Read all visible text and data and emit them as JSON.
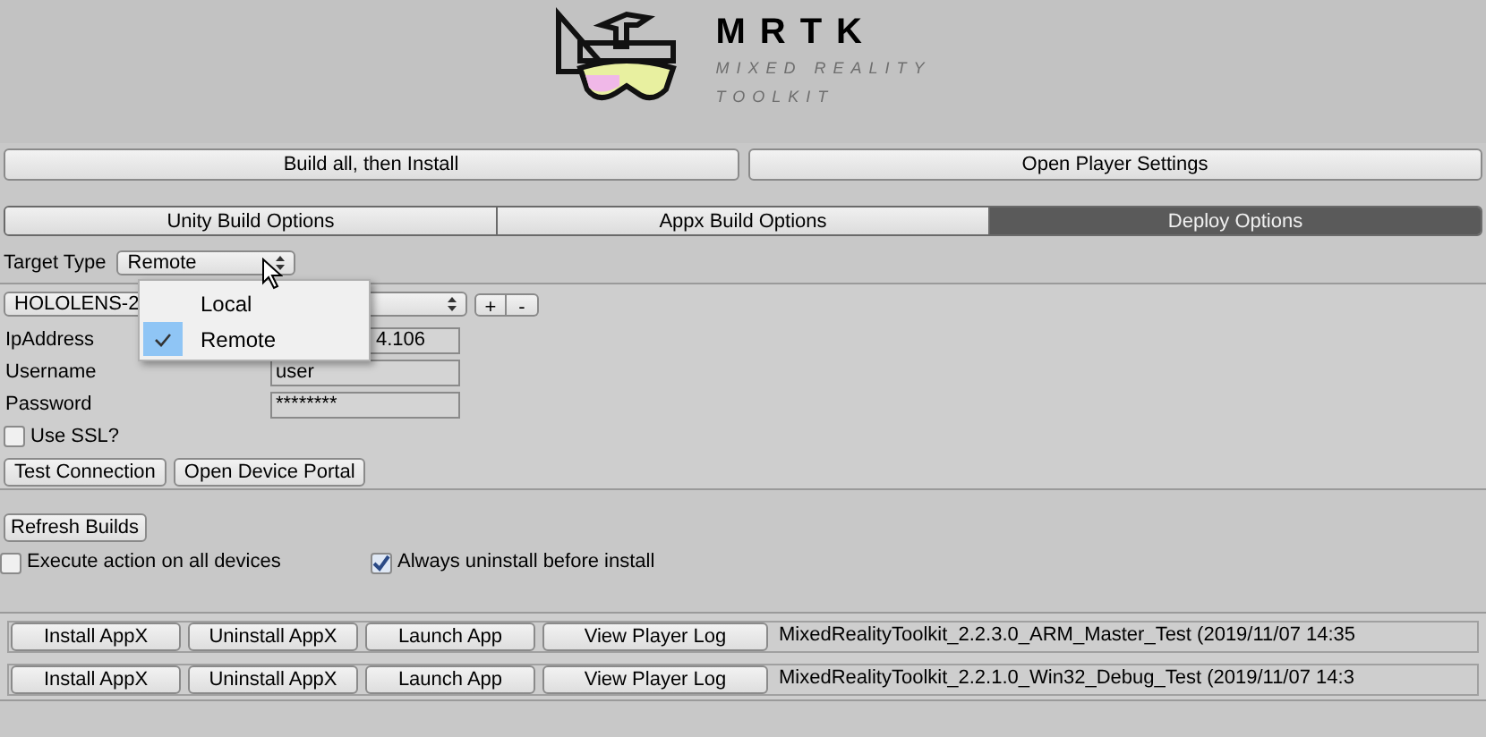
{
  "logo": {
    "title": "MRTK",
    "subtitle_lines": [
      "MIXED REALITY",
      "TOOLKIT"
    ]
  },
  "top_buttons": [
    "Build all, then Install",
    "Open Player Settings"
  ],
  "tabs": [
    {
      "label": "Unity Build Options",
      "selected": false
    },
    {
      "label": "Appx Build Options",
      "selected": false
    },
    {
      "label": "Deploy Options",
      "selected": true
    }
  ],
  "target_type": {
    "label": "Target Type",
    "value": "Remote",
    "menu": [
      {
        "label": "Local",
        "selected": false
      },
      {
        "label": "Remote",
        "selected": true
      }
    ]
  },
  "device": {
    "dropdown": "HOLOLENS-2",
    "add": "+",
    "remove": "-",
    "fields": [
      {
        "label": "IpAddress",
        "value": "4.106"
      },
      {
        "label": "Username",
        "value": "user"
      },
      {
        "label": "Password",
        "value": "********"
      }
    ],
    "use_ssl": {
      "label": "Use SSL?",
      "checked": false
    },
    "buttons": [
      "Test Connection",
      "Open Device Portal"
    ]
  },
  "refresh": "Refresh Builds",
  "options": [
    {
      "label": "Execute action on all devices",
      "checked": false
    },
    {
      "label": "Always uninstall before install",
      "checked": true
    }
  ],
  "builds": [
    {
      "buttons": [
        "Install AppX",
        "Uninstall AppX",
        "Launch App",
        "View Player Log"
      ],
      "name": "MixedRealityToolkit_2.2.3.0_ARM_Master_Test (2019/11/07 14:35"
    },
    {
      "buttons": [
        "Install AppX",
        "Uninstall AppX",
        "Launch App",
        "View Player Log"
      ],
      "name": "MixedRealityToolkit_2.2.1.0_Win32_Debug_Test (2019/11/07 14:3"
    }
  ]
}
